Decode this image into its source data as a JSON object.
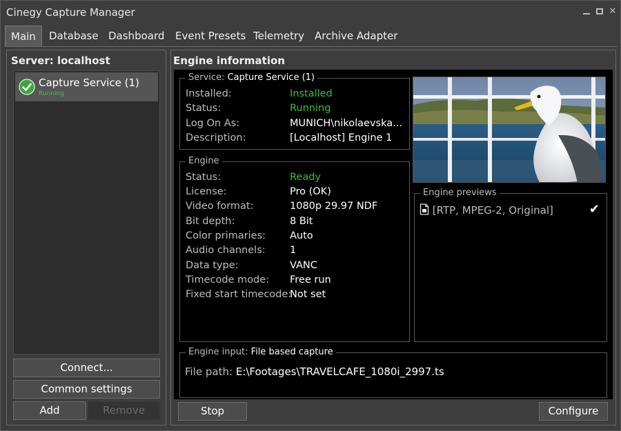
{
  "window": {
    "title": "Cinegy Capture Manager"
  },
  "tabs": [
    {
      "label": "Main",
      "active": true
    },
    {
      "label": "Database"
    },
    {
      "label": "Dashboard"
    },
    {
      "label": "Event Presets"
    },
    {
      "label": "Telemetry"
    },
    {
      "label": "Archive Adapter"
    }
  ],
  "left": {
    "title": "Server: localhost",
    "server": {
      "name": "Capture Service (1)",
      "status": "Running"
    },
    "buttons": {
      "connect": "Connect...",
      "common_settings": "Common settings",
      "add": "Add",
      "remove": "Remove"
    }
  },
  "right": {
    "title": "Engine information",
    "service": {
      "legend_label": "Service:",
      "legend_value": "Capture Service (1)",
      "rows": [
        {
          "label": "Installed:",
          "value": "Installed",
          "color": "#35c235"
        },
        {
          "label": "Status:",
          "value": "Running",
          "color": "#35c235"
        },
        {
          "label": "Log On As:",
          "value": "MUNICH\\nikolaevska..."
        },
        {
          "label": "Description:",
          "value": "[Localhost] Engine 1"
        }
      ]
    },
    "engine": {
      "legend": "Engine",
      "rows": [
        {
          "label": "Status:",
          "value": "Ready",
          "color": "#35c235"
        },
        {
          "label": "License:",
          "value": "Pro (OK)"
        },
        {
          "label": "Video format:",
          "value": "1080p 29.97 NDF"
        },
        {
          "label": "Bit depth:",
          "value": "8 Bit"
        },
        {
          "label": "Color primaries:",
          "value": "Auto"
        },
        {
          "label": "Audio channels:",
          "value": "1"
        },
        {
          "label": "Data type:",
          "value": "VANC"
        },
        {
          "label": "Timecode mode:",
          "value": "Free run"
        },
        {
          "label": "Fixed start timecode:",
          "value": "Not set"
        }
      ]
    },
    "previews": {
      "legend": "Engine previews",
      "item": "[RTP, MPEG-2, Original]"
    },
    "input": {
      "legend_label": "Engine input:",
      "legend_value": "File based capture",
      "path_label": "File path:",
      "path_value": "E:\\Footages\\TRAVELCAFE_1080i_2997.ts"
    },
    "buttons": {
      "stop": "Stop",
      "configure": "Configure"
    }
  }
}
